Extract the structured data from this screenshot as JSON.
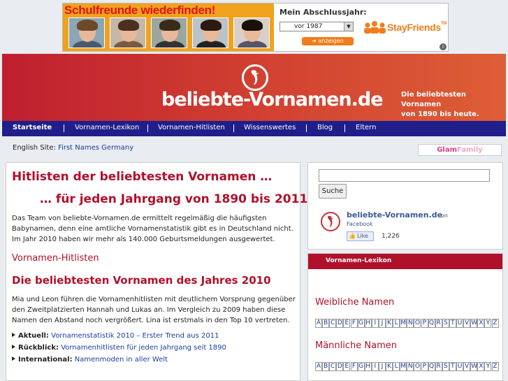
{
  "ad": {
    "headline": "Schulfreunde wiederfinden!",
    "year_label": "Mein Abschlussjahr:",
    "year_value": "vor 1987",
    "show_button": "anzeigen",
    "brand": "StayFriends",
    "brand_tm": "TM",
    "info": "i"
  },
  "header": {
    "site_name": "beliebte-Vornamen.de",
    "tagline_line1": "Die beliebtesten Vornamen",
    "tagline_line2": "von 1890 bis heute."
  },
  "nav": {
    "items": [
      "Startseite",
      "Vornamen-Lexikon",
      "Vornamen-Hitlisten",
      "Wissenswertes",
      "Blog",
      "Eltern"
    ]
  },
  "english": {
    "label": "English Site:",
    "link": "First Names Germany"
  },
  "glam": {
    "part1": "Glam",
    "part2": "Family"
  },
  "main": {
    "h1a": "Hitlisten der beliebtesten Vornamen …",
    "h1b": "… für jeden Jahrgang von 1890 bis 2011",
    "intro": "Das Team von beliebte-Vornamen.de ermittelt regelmäßig die häufigsten Babynamen, denn eine amtliche Vornamenstatistik gibt es in Deutschland nicht. Im Jahr 2010 haben wir mehr als 140.000 Geburtsmeldungen ausgewertet.",
    "h2a": "Vornamen-Hitlisten",
    "h2b": "Die beliebtesten Vornamen des Jahres 2010",
    "para2": "Mia und Leon führen die Vornamenhitlisten mit deutlichem Vorsprung gegenüber den Zweitplatzierten Hannah und Lukas an. Im Vergleich zu 2009 haben diese Namen den Abstand noch vergrößert. Lina ist erstmals in den Top 10 vertreten.",
    "bullets": [
      {
        "label": "Aktuell:",
        "link": "Vornamenstatistik 2010 – Erster Trend aus 2011"
      },
      {
        "label": "Rückblick:",
        "link": "Vornamenhitlisten für jeden Jahrgang seit 1890"
      },
      {
        "label": "International:",
        "link": "Namenmoden in aller Welt"
      }
    ]
  },
  "search": {
    "button": "Suche",
    "placeholder": ""
  },
  "facebook": {
    "name": "beliebte-Vornamen.de",
    "on": "on",
    "network": "Facebook",
    "like": "Like",
    "count": "1,226"
  },
  "lexikon": {
    "title": "Vornamen-Lexikon",
    "female": "Weibliche Namen",
    "male": "Männliche Namen",
    "letters": [
      "A",
      "B",
      "C",
      "D",
      "E",
      "F",
      "G",
      "H",
      "I",
      "J",
      "K",
      "L",
      "M",
      "N",
      "O",
      "P",
      "Q",
      "R",
      "S",
      "T",
      "U",
      "V",
      "W",
      "X",
      "Y",
      "Z"
    ]
  },
  "colors": {
    "brand_red": "#b1102a",
    "nav_blue": "#1f1e8a",
    "link_blue": "#1b3c9e",
    "ad_orange": "#f0a21c"
  }
}
